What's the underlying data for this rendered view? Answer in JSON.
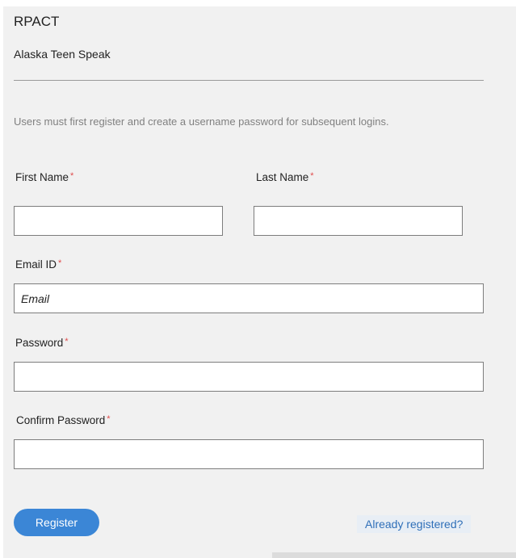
{
  "header": {
    "app_title": "RPACT",
    "org_name": "Alaska Teen Speak"
  },
  "instructions": "Users must first register and create a username password for subsequent logins.",
  "form": {
    "required_marker": "*",
    "first_name": {
      "label": "First Name",
      "value": "",
      "placeholder": ""
    },
    "last_name": {
      "label": "Last Name",
      "value": "",
      "placeholder": ""
    },
    "email": {
      "label": "Email ID",
      "value": "",
      "placeholder": "Email"
    },
    "password": {
      "label": "Password",
      "value": "",
      "placeholder": ""
    },
    "confirm_password": {
      "label": "Confirm Password",
      "value": "",
      "placeholder": ""
    }
  },
  "actions": {
    "register_label": "Register",
    "already_registered_label": "Already registered?"
  },
  "colors": {
    "panel_bg": "#f1f1f1",
    "accent": "#3b86d6",
    "link": "#2f6fb8",
    "required": "#e04b4b"
  }
}
